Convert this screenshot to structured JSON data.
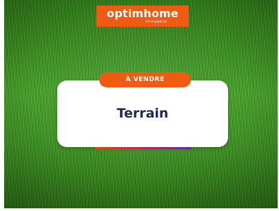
{
  "brand": {
    "name": "optimhome",
    "subtitle": "immobilier",
    "color": "#f05a12"
  },
  "badge": {
    "label": "À VENDRE"
  },
  "card": {
    "title": "Terrain"
  },
  "colors": {
    "title": "#1f2a4a",
    "grass": "#3f9623"
  }
}
